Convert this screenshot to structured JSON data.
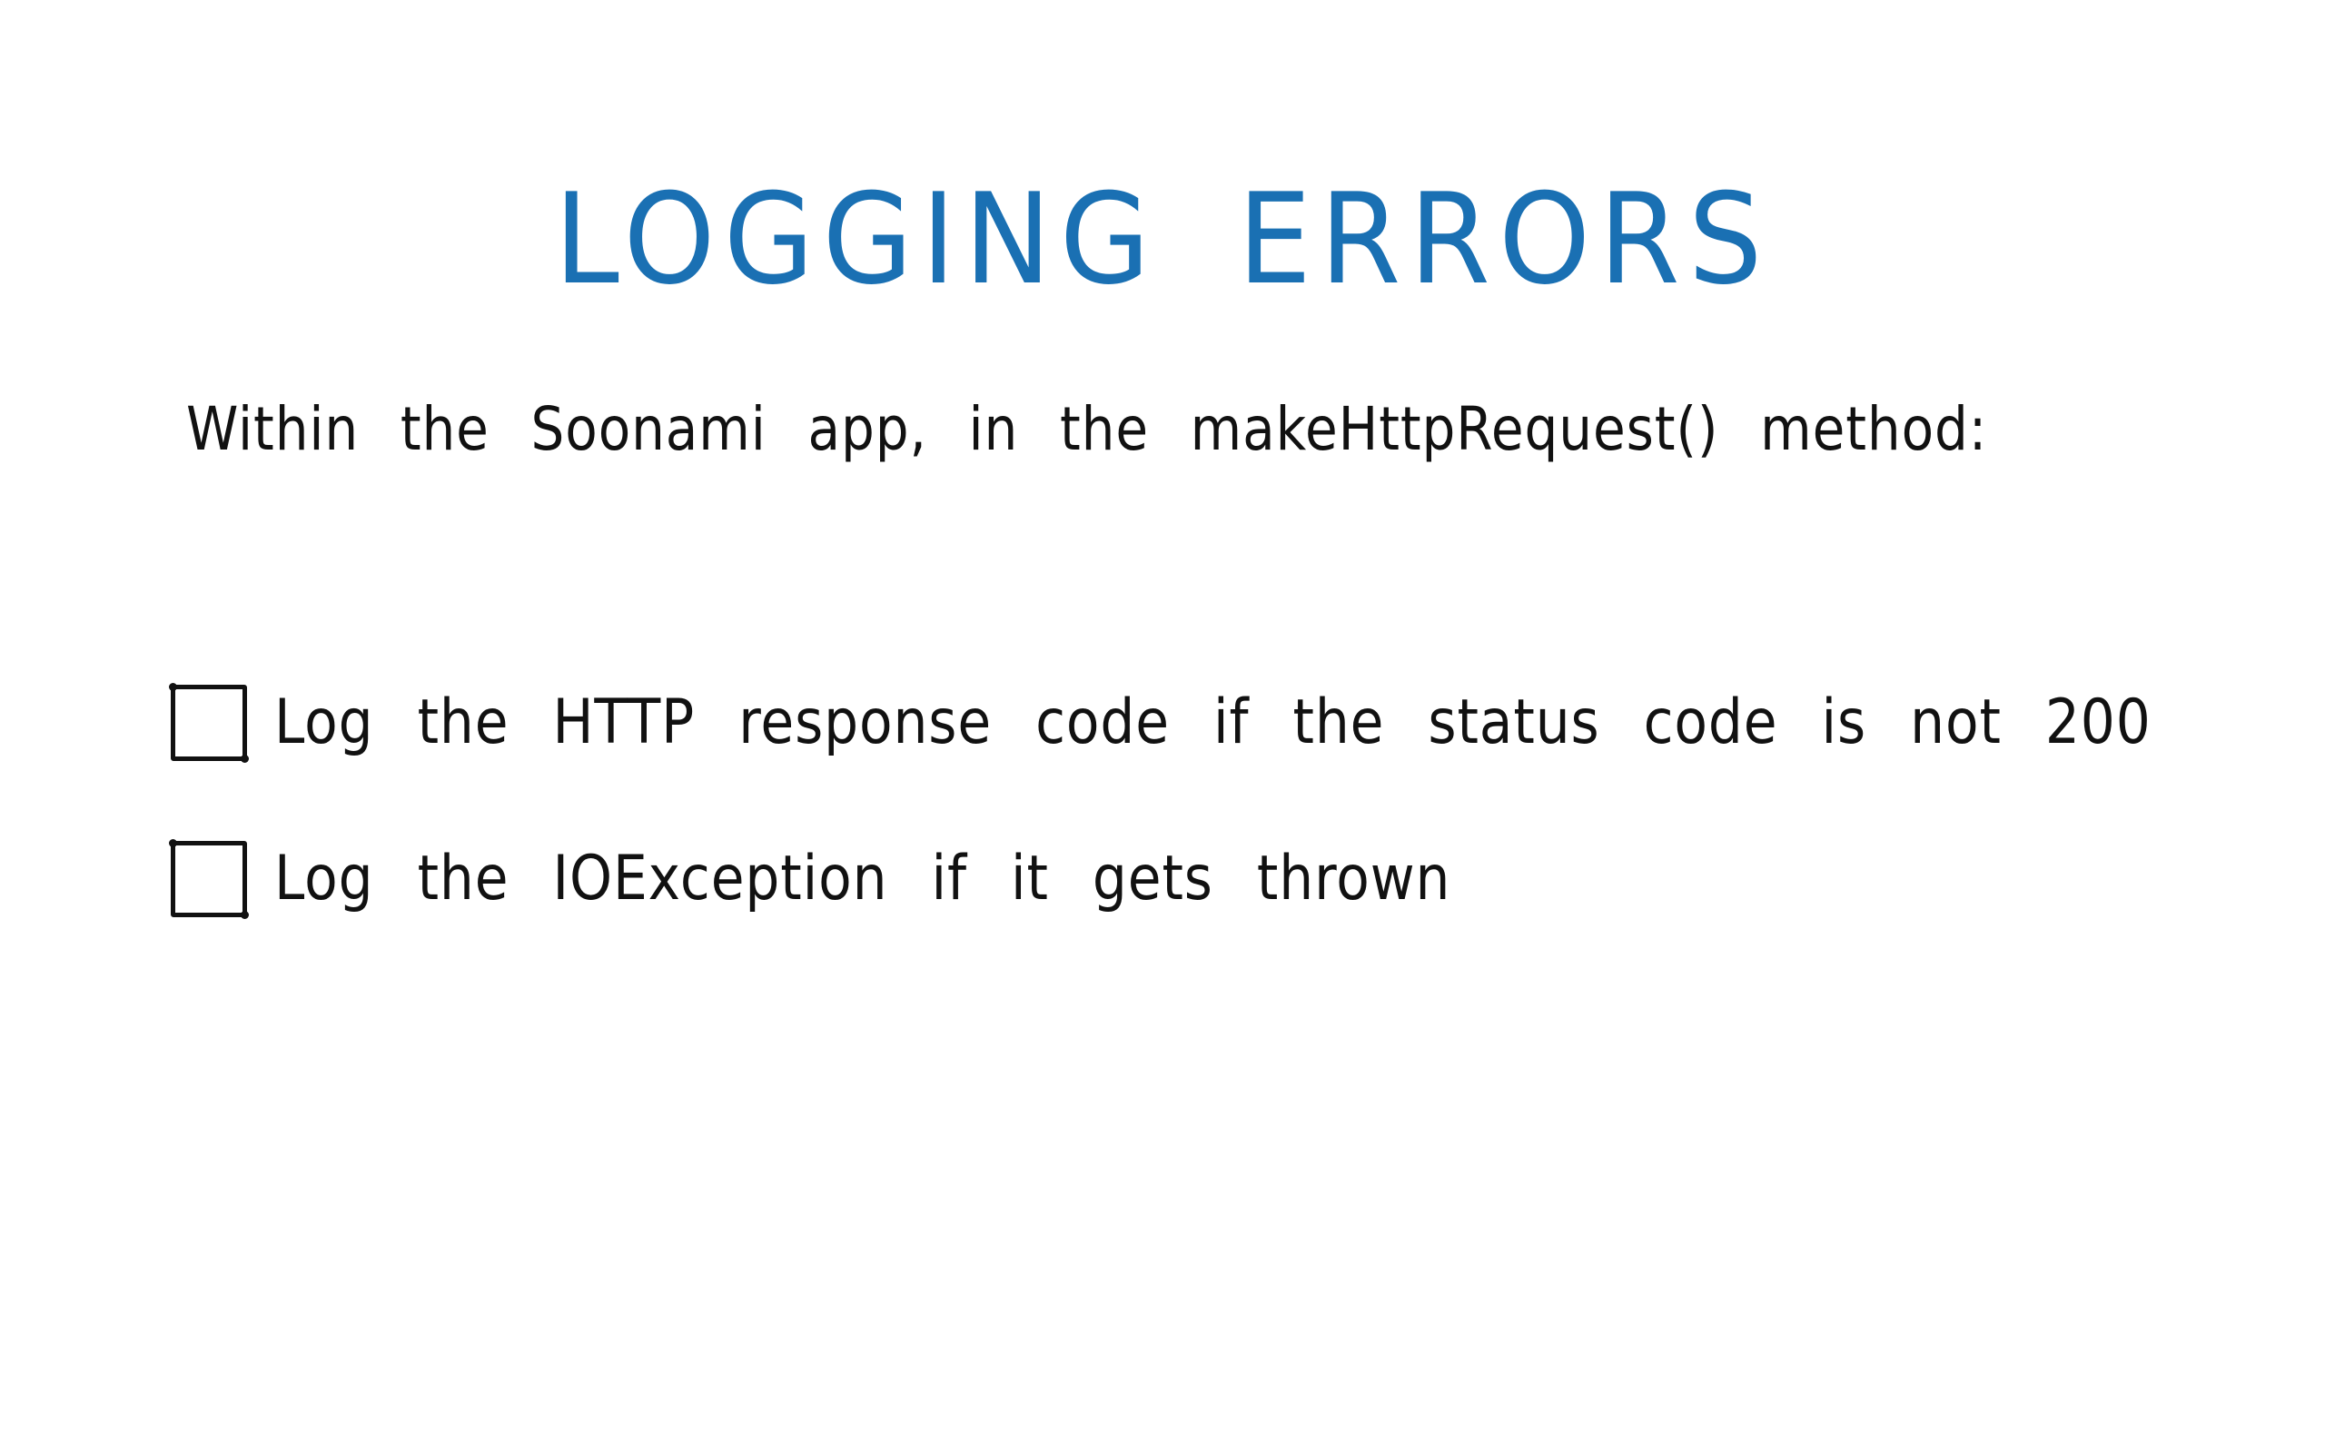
{
  "slide": {
    "title": "LOGGING ERRORS",
    "intro": "Within the Soonami app, in the makeHttpRequest() method:",
    "tasks": [
      {
        "label": "Log the HTTP response code if the status code is not 200",
        "checked": false
      },
      {
        "label": "Log the IOException if it gets thrown",
        "checked": false
      }
    ]
  },
  "colors": {
    "title": "#1a70b3",
    "text": "#111111",
    "background": "#ffffff"
  },
  "icons": {
    "checkbox": "empty-checkbox-icon"
  }
}
